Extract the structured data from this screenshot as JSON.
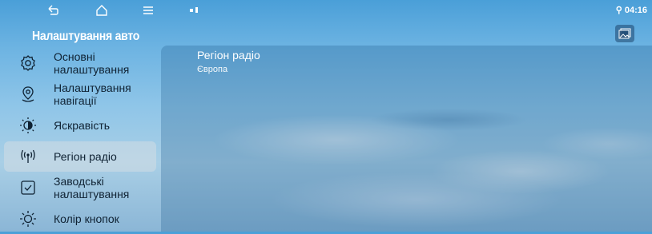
{
  "status_bar": {
    "back_icon": "back-icon",
    "home_icon": "home-icon",
    "menu_icon": "menu-icon",
    "time": "04:16"
  },
  "sidebar": {
    "title": "Налаштування авто",
    "items": [
      {
        "label": "Основні налаштування",
        "icon": "gear-icon",
        "active": false
      },
      {
        "label": "Налаштування навігації",
        "icon": "location-pin-icon",
        "active": false
      },
      {
        "label": "Яскравість",
        "icon": "brightness-icon",
        "active": false
      },
      {
        "label": "Регіон радіо",
        "icon": "radio-antenna-icon",
        "active": true
      },
      {
        "label": "Заводські налаштування",
        "icon": "checkbox-icon",
        "active": false
      },
      {
        "label": "Колір кнопок",
        "icon": "sun-icon",
        "active": false
      }
    ]
  },
  "content": {
    "title": "Регіон радіо",
    "value": "Європа"
  },
  "colors": {
    "sky_top": "#4a9fd8",
    "panel": "#1e5a8c",
    "nav_text": "#0f2233",
    "active_bg": "#d2dce4"
  }
}
